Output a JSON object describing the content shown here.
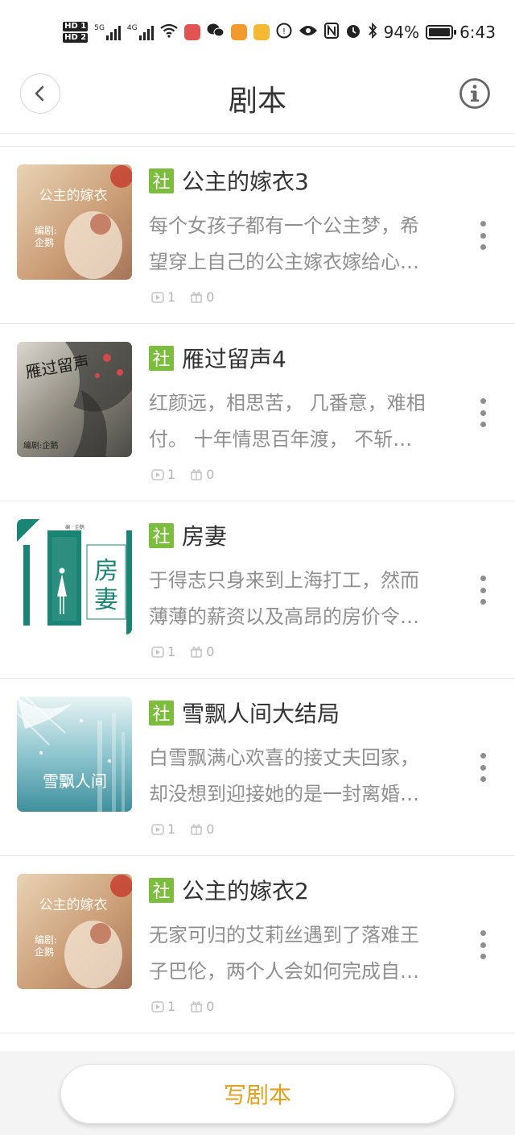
{
  "status_bar": {
    "hd1": "HD 1",
    "hd2": "HD 2",
    "sig1_label": "5G",
    "sig2_label": "4G",
    "battery": "94%",
    "time": "6:43"
  },
  "header": {
    "title": "剧本",
    "back_icon": "chevron-left-icon",
    "info_icon": "info-circle-icon"
  },
  "scripts": [
    {
      "badge": "社",
      "title": "公主的嫁衣3",
      "desc_line1": "每个女孩子都有一个公主梦，希",
      "desc_line2": "望穿上自己的公主嫁衣嫁给心…",
      "plays": "1",
      "gifts": "0",
      "cover_text": "公主的嫁衣"
    },
    {
      "badge": "社",
      "title": "雁过留声4",
      "desc_line1": "红颜远，相思苦， 几番意，难相",
      "desc_line2": "付。 十年情思百年渡， 不斩…",
      "plays": "1",
      "gifts": "0",
      "cover_text": "雁过留声"
    },
    {
      "badge": "社",
      "title": "房妻",
      "desc_line1": "于得志只身来到上海打工，然而",
      "desc_line2": "薄薄的薪资以及高昂的房价令…",
      "plays": "1",
      "gifts": "0",
      "cover_text": "房妻"
    },
    {
      "badge": "社",
      "title": "雪飘人间大结局",
      "desc_line1": "白雪飘满心欢喜的接丈夫回家，",
      "desc_line2": "却没想到迎接她的是一封离婚…",
      "plays": "1",
      "gifts": "0",
      "cover_text": "雪飘人间"
    },
    {
      "badge": "社",
      "title": "公主的嫁衣2",
      "desc_line1": "无家可归的艾莉丝遇到了落难王",
      "desc_line2": "子巴伦，两个人会如何完成自…",
      "plays": "1",
      "gifts": "0",
      "cover_text": "公主的嫁衣"
    }
  ],
  "bottom": {
    "write_label": "写剧本"
  },
  "colors": {
    "badge_green": "#7cbd3e",
    "accent_orange": "#e0a21e"
  }
}
